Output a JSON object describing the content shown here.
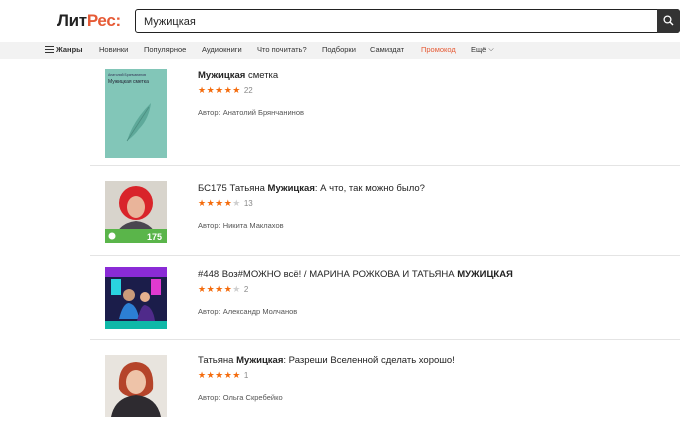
{
  "header": {
    "logo_part1": "Лит",
    "logo_part2": "Рес",
    "logo_colon": ":",
    "search_value": "Мужицкая"
  },
  "nav": {
    "genres_label": "Жанры",
    "items": [
      "Новинки",
      "Популярное",
      "Аудиокниги",
      "Что почитать?",
      "Подборки",
      "Самиздат",
      "Промокод",
      "Ещё"
    ]
  },
  "results": [
    {
      "title_pre": "",
      "title_bold": "Мужицкая",
      "title_post": " сметка",
      "stars_filled": "★★★★★",
      "stars_empty": "",
      "rating_count": "22",
      "author_label": "Автор:",
      "author_name": "Анатолий Брянчанинов",
      "cover_author": "Анатолий Брянчанинов",
      "cover_title": "Мужицкая сметка"
    },
    {
      "title_pre": "БС175 Татьяна ",
      "title_bold": "Мужицкая",
      "title_post": ": А что, так можно было?",
      "stars_filled": "★★★★",
      "stars_empty": "★",
      "rating_count": "13",
      "author_label": "Автор:",
      "author_name": "Никита Маклахов",
      "cover_badge": "175"
    },
    {
      "title_pre": "#448 Воз#МОЖНО всё! / МАРИНА РОЖКОВА И ТАТЬЯНА ",
      "title_bold": "МУЖИЦКАЯ",
      "title_post": "",
      "stars_filled": "★★★★",
      "stars_empty": "★",
      "rating_count": "2",
      "author_label": "Автор:",
      "author_name": "Александр Молчанов"
    },
    {
      "title_pre": "Татьяна ",
      "title_bold": "Мужицкая",
      "title_post": ": Разреши Вселенной сделать хорошо!",
      "stars_filled": "★★★★★",
      "stars_empty": "",
      "rating_count": "1",
      "author_label": "Автор:",
      "author_name": "Ольга Скребейко"
    }
  ],
  "colors": {
    "brand": "#e65a35",
    "star": "#f46b0c",
    "nav_bg": "#f2f2f2"
  }
}
